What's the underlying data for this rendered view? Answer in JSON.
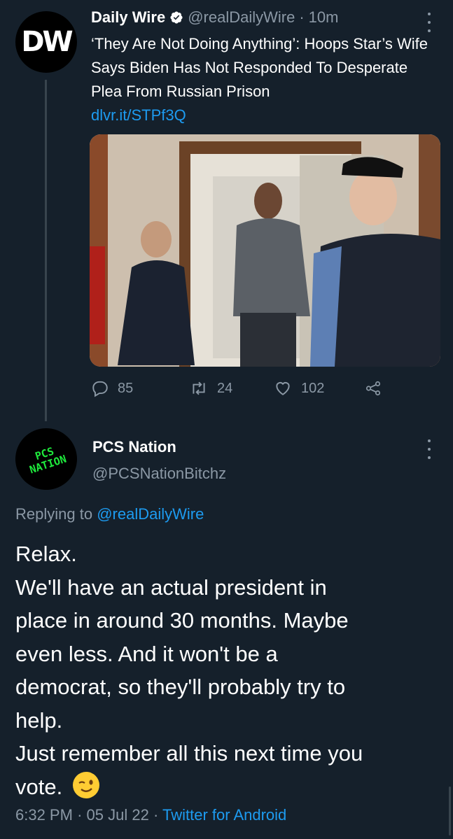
{
  "parent_tweet": {
    "avatar_text": "DW",
    "name": "Daily Wire",
    "handle": "@realDailyWire",
    "separator": "·",
    "time": "10m",
    "text": "‘They Are Not Doing Anything’: Hoops Star’s Wife Says Biden Has Not Responded To Desperate Plea From Russian Prison",
    "link": "dlvr.it/STPf3Q",
    "actions": {
      "replies": "85",
      "retweets": "24",
      "likes": "102"
    }
  },
  "reply_tweet": {
    "avatar_text_line1": "PCS",
    "avatar_text_line2": "NATION",
    "name": "PCS Nation",
    "handle": "@PCSNationBitchz",
    "replying_prefix": "Replying to",
    "replying_handle": "@realDailyWire",
    "text_lines": [
      "Relax.",
      "We'll have an actual president in",
      "place in around 30 months. Maybe",
      "even less. And it won't be a",
      "democrat, so they'll probably try to",
      "help.",
      "Just remember all this next time you",
      "vote."
    ],
    "time": "6:32 PM",
    "date": "05 Jul 22",
    "separator": "·",
    "source": "Twitter for Android"
  },
  "colors": {
    "background": "#15202b",
    "accent": "#1d9bf0",
    "muted": "#8b98a5",
    "avatar_green": "#1ee93c"
  },
  "icons": [
    "verified-badge-icon",
    "more-icon",
    "reply-icon",
    "retweet-icon",
    "like-icon",
    "share-icon",
    "wink-emoji-icon"
  ]
}
